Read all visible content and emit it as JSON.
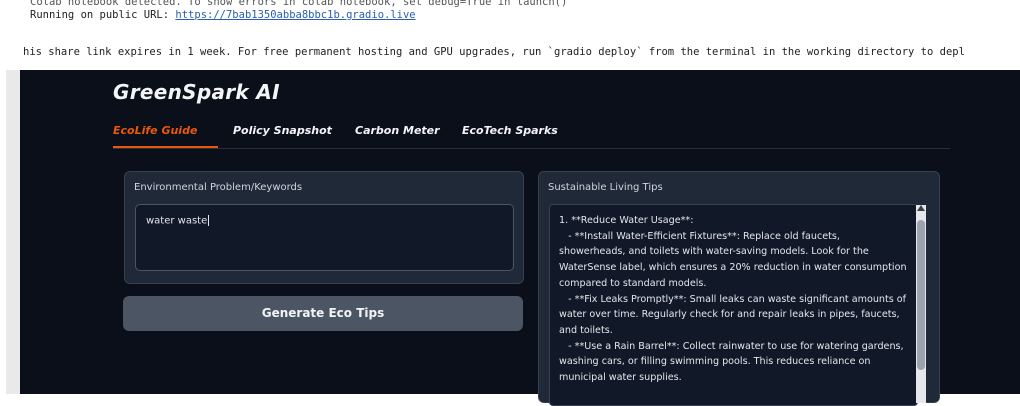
{
  "console": {
    "line_top": "Colab notebook detected. To show errors in colab notebook, set debug=True in launch()",
    "running_prefix": "Running on public URL: ",
    "public_url": "https://7bab1350abba8bbc1b.gradio.live",
    "share_notice": "his share link expires in 1 week. For free permanent hosting and GPU upgrades, run `gradio deploy` from the terminal in the working directory to depl"
  },
  "app": {
    "title": "GreenSpark AI"
  },
  "tabs": [
    {
      "label": "EcoLife Guide",
      "active": true
    },
    {
      "label": "Policy Snapshot",
      "active": false
    },
    {
      "label": "Carbon Meter",
      "active": false
    },
    {
      "label": "EcoTech Sparks",
      "active": false
    }
  ],
  "input_panel": {
    "label": "Environmental Problem/Keywords",
    "value": "water waste"
  },
  "generate_button": {
    "label": "Generate Eco Tips"
  },
  "output_panel": {
    "label": "Sustainable Living Tips",
    "text": "1. **Reduce Water Usage**:\n   - **Install Water-Efficient Fixtures**: Replace old faucets, showerheads, and toilets with water-saving models. Look for the WaterSense label, which ensures a 20% reduction in water consumption compared to standard models.\n   - **Fix Leaks Promptly**: Small leaks can waste significant amounts of water over time. Regularly check for and repair leaks in pipes, faucets, and toilets.\n   - **Use a Rain Barrel**: Collect rainwater to use for watering gardens, washing cars, or filling swimming pools. This reduces reliance on municipal water supplies."
  },
  "colors": {
    "background": "#0b0f19",
    "panel": "#1f2937",
    "accent": "#ea580c",
    "button": "#4b5563"
  }
}
